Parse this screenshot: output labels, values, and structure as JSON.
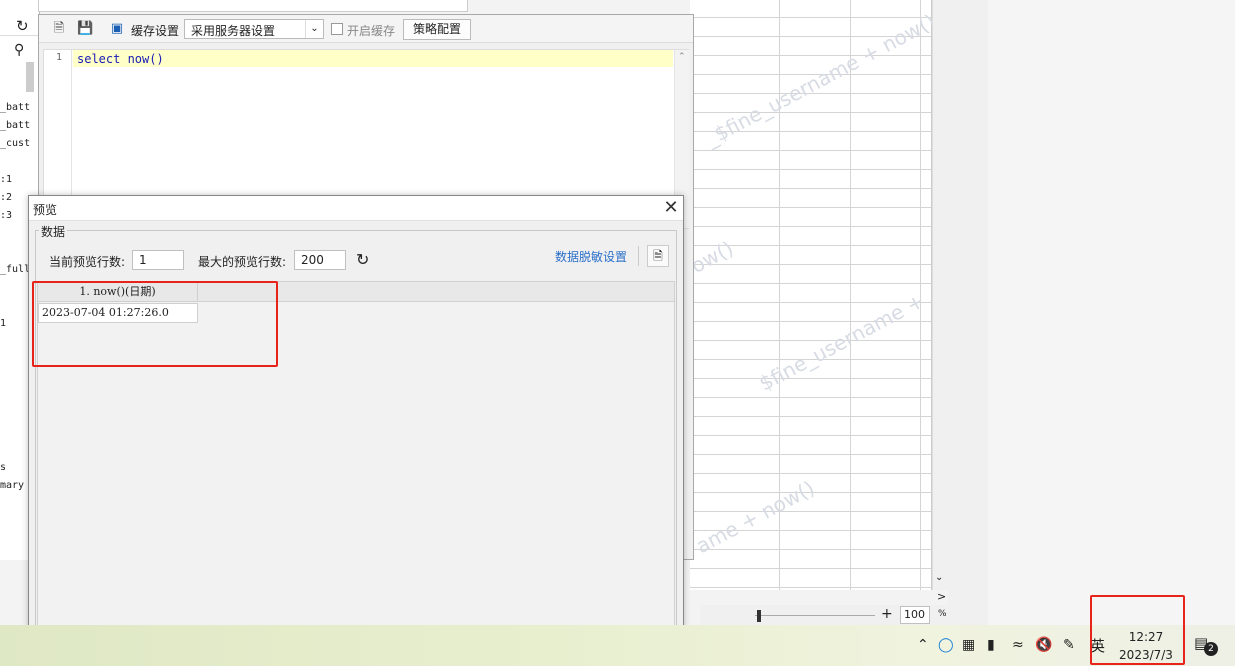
{
  "editor": {
    "toolbar": {
      "cache_label": "缓存设置",
      "cache_select_value": "采用服务器设置",
      "enable_cache_label": "开启缓存",
      "policy_button": "策略配置"
    },
    "line_number": "1",
    "sql": "select now()"
  },
  "tree": {
    "items": [
      "_batt",
      "_batt",
      "_cust",
      ":1",
      ":2",
      ":3",
      "_full",
      "1",
      "s",
      "mary"
    ]
  },
  "preview": {
    "title": "预览",
    "close_icon": "close-icon",
    "group_label": "数据",
    "current_rows_label": "当前预览行数:",
    "current_rows_value": "1",
    "max_rows_label": "最大的预览行数:",
    "max_rows_value": "200",
    "mask_link": "数据脱敏设置",
    "table": {
      "columns": [
        "1. now()(日期)"
      ],
      "rows": [
        [
          "2023-07-04 01:27:26.0"
        ]
      ]
    }
  },
  "sheet": {
    "watermarks": [
      "_$fine_username + now()",
      "ow()",
      "$fine_username +",
      "ame + now()"
    ]
  },
  "zoom": {
    "value": "100",
    "unit": "%"
  },
  "taskbar": {
    "ime": "英",
    "time": "12:27",
    "date": "2023/7/3",
    "notification_count": "2"
  },
  "colors": {
    "highlight": "#e8231a",
    "link": "#2a6fc9",
    "sql_keyword": "#1a1ab8"
  }
}
